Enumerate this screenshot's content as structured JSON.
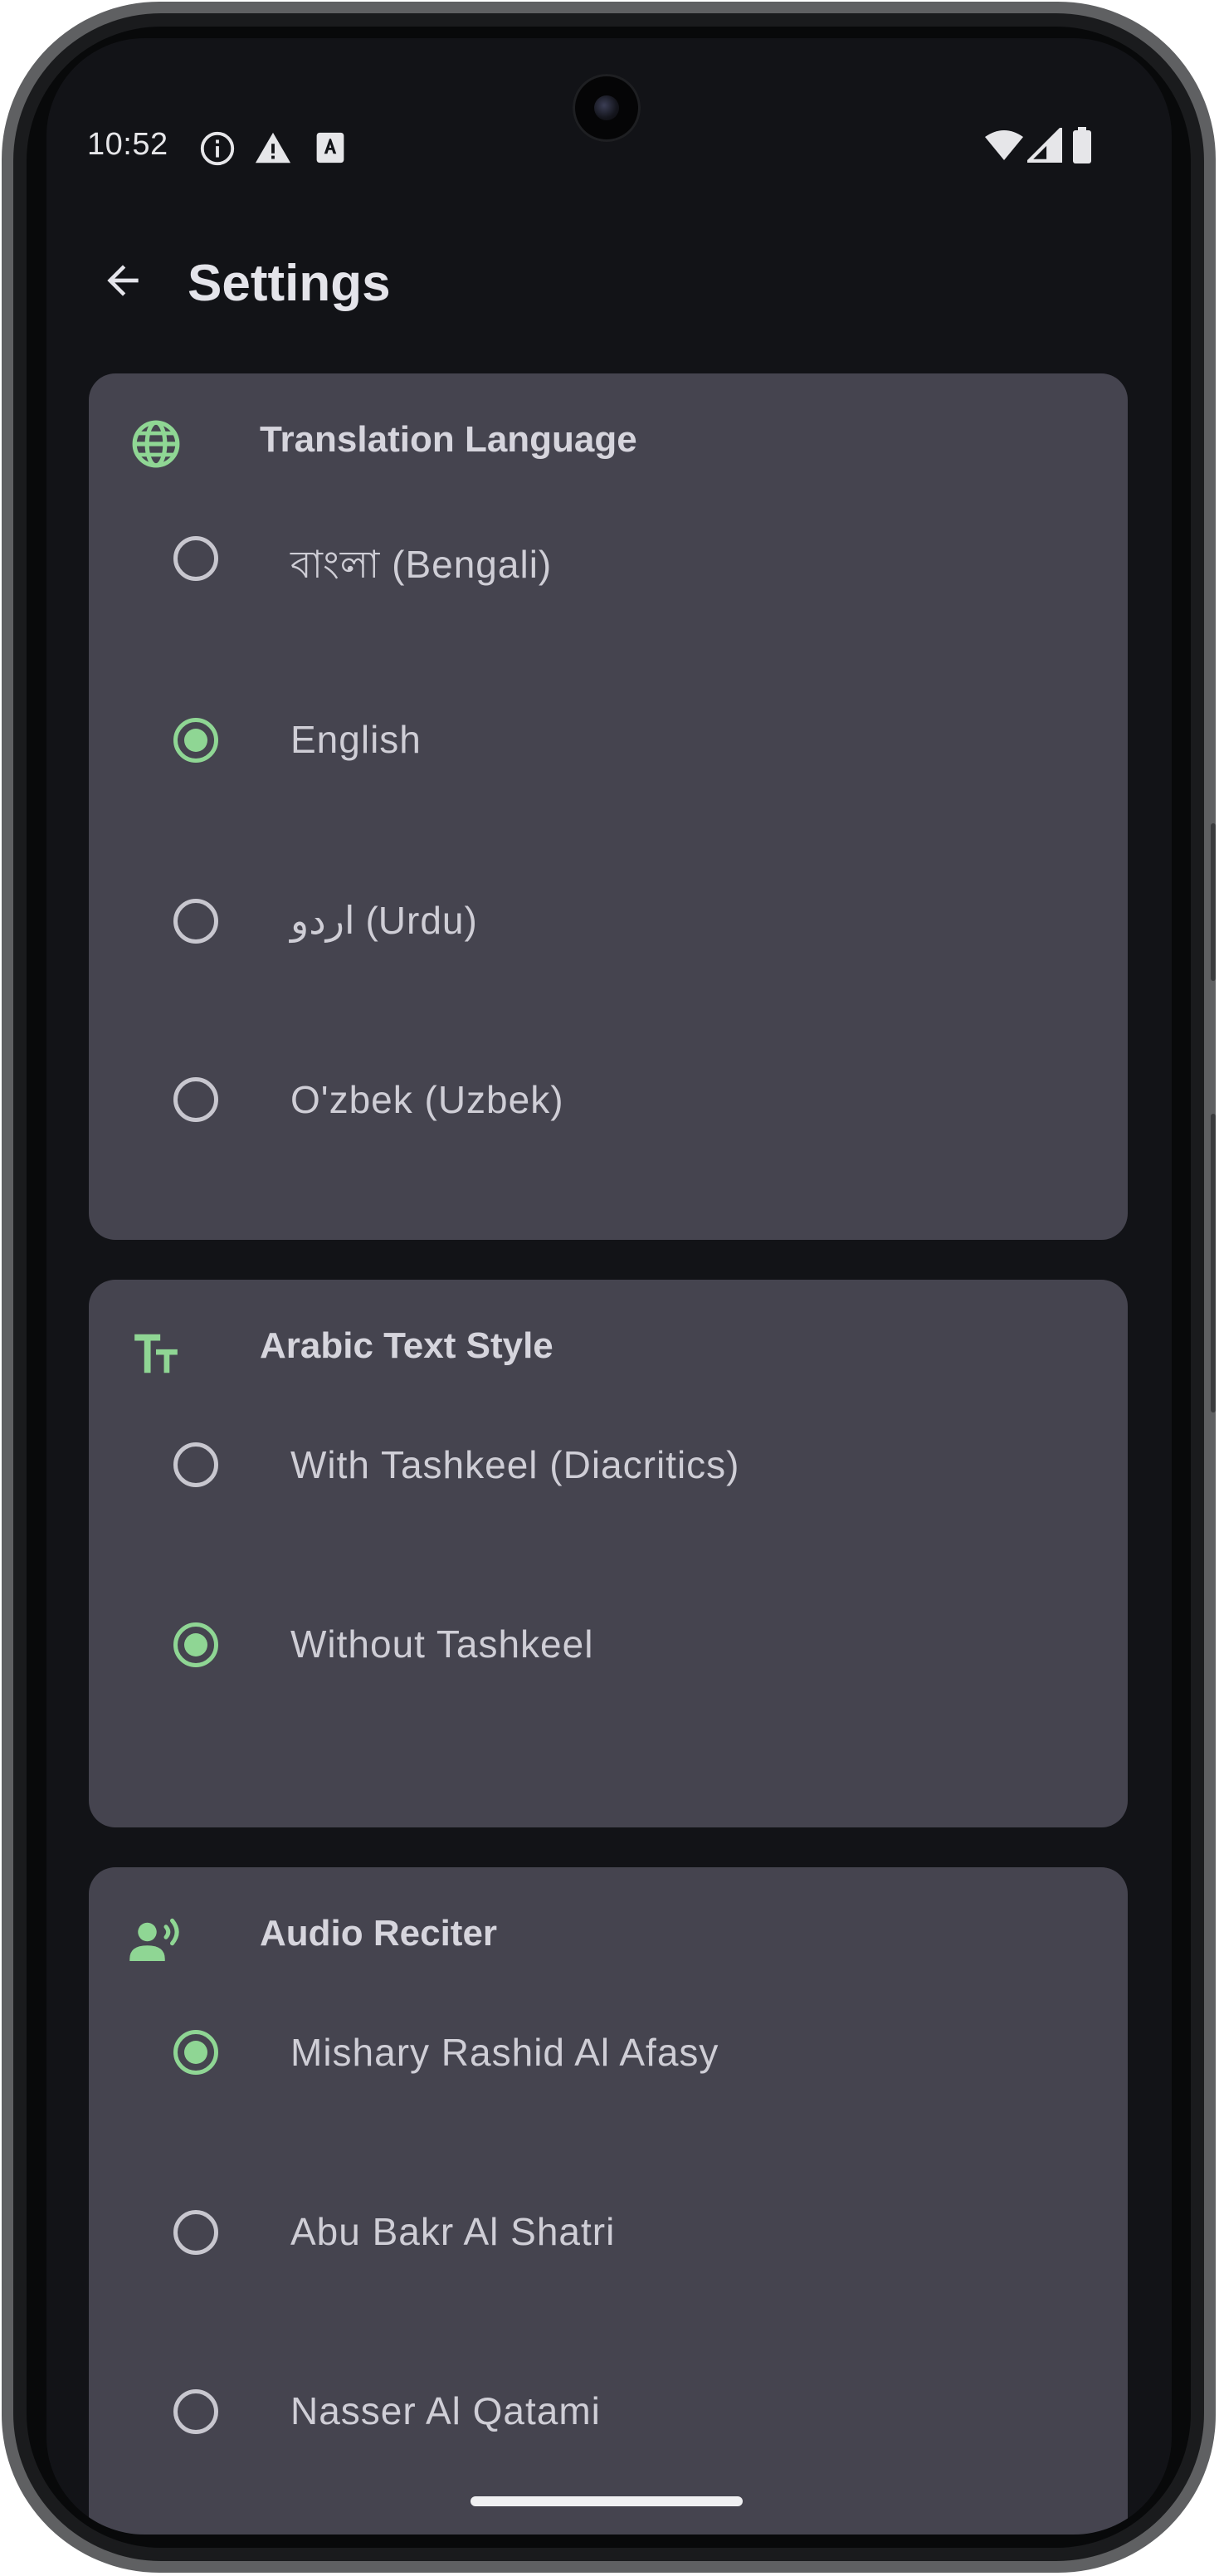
{
  "status_bar": {
    "time": "10:52",
    "left_icons": [
      "info-icon",
      "warning-icon",
      "app-notification-icon"
    ],
    "right_icons": [
      "wifi-icon",
      "cellular-signal-icon",
      "battery-icon"
    ]
  },
  "app_bar": {
    "back_icon": "arrow-back-icon",
    "title": "Settings"
  },
  "sections": [
    {
      "id": "translation-language",
      "icon": "globe-icon",
      "title": "Translation Language",
      "options": [
        {
          "label": "বাংলা (Bengali)",
          "selected": false
        },
        {
          "label": "English",
          "selected": true
        },
        {
          "label": "اردو (Urdu)",
          "selected": false
        },
        {
          "label": "O'zbek (Uzbek)",
          "selected": false
        }
      ]
    },
    {
      "id": "arabic-text-style",
      "icon": "text-size-icon",
      "title": "Arabic Text Style",
      "options": [
        {
          "label": "With Tashkeel (Diacritics)",
          "selected": false
        },
        {
          "label": "Without Tashkeel",
          "selected": true
        }
      ]
    },
    {
      "id": "audio-reciter",
      "icon": "voice-person-icon",
      "title": "Audio Reciter",
      "options": [
        {
          "label": "Mishary Rashid Al Afasy",
          "selected": true
        },
        {
          "label": "Abu Bakr Al Shatri",
          "selected": false
        },
        {
          "label": "Nasser Al Qatami",
          "selected": false
        }
      ]
    }
  ],
  "colors": {
    "background": "#121317",
    "card": "#45444f",
    "accent": "#8fd694",
    "text": "#cfced6"
  }
}
